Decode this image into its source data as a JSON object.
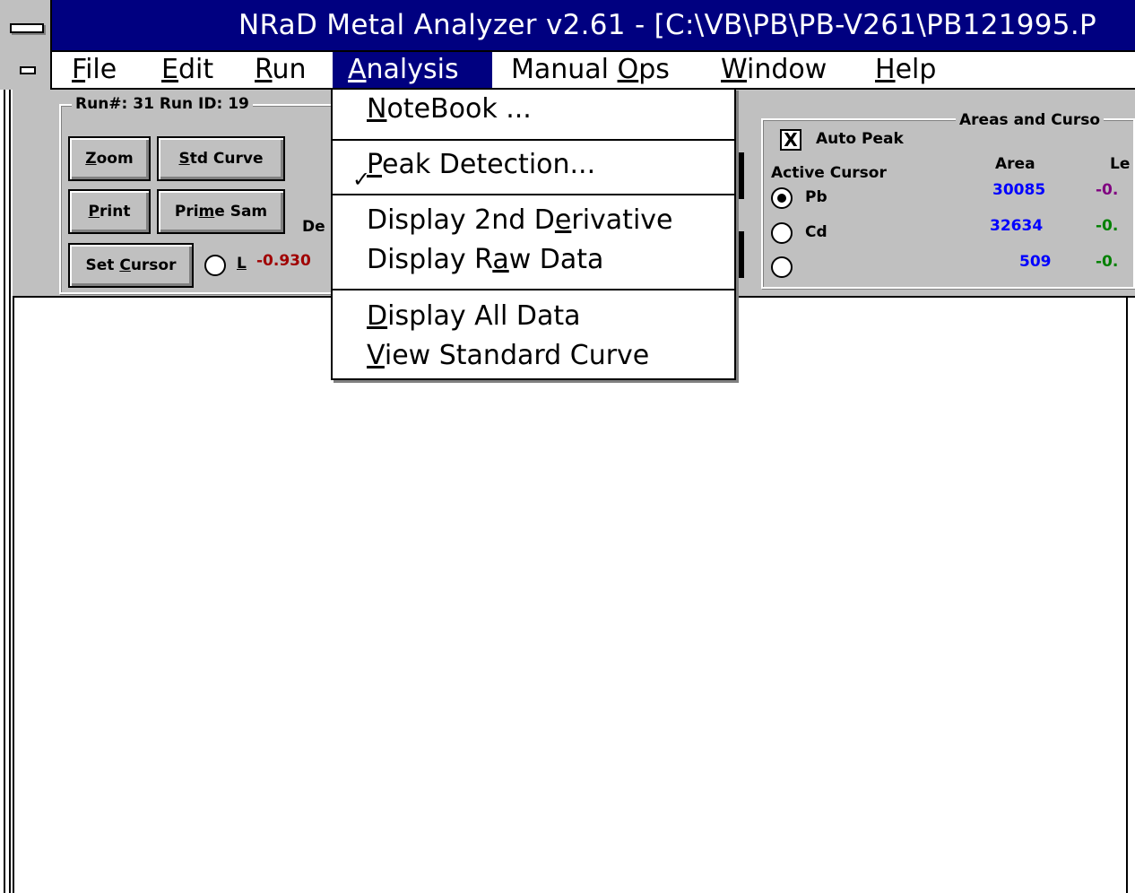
{
  "window": {
    "title": "NRaD Metal Analyzer v2.61 - [C:\\VB\\PB\\PB-V261\\PB121995.P"
  },
  "menubar": {
    "items": [
      {
        "label": "File",
        "mnemonic": "F",
        "rest": "ile"
      },
      {
        "label": "Edit",
        "mnemonic": "E",
        "rest": "dit"
      },
      {
        "label": "Run",
        "mnemonic": "R",
        "rest": "un"
      },
      {
        "label": "Analysis",
        "mnemonic": "A",
        "rest": "nalysis"
      },
      {
        "label": "Manual Ops",
        "pre": "Manual ",
        "mnemonic": "O",
        "rest": "ps"
      },
      {
        "label": "Window",
        "mnemonic": "W",
        "rest": "indow"
      },
      {
        "label": "Help",
        "mnemonic": "H",
        "rest": "elp"
      }
    ]
  },
  "analysis_menu": {
    "items": [
      {
        "pre": "",
        "mnemonic": "N",
        "rest": "oteBook ..."
      },
      {
        "pre": "",
        "mnemonic": "P",
        "rest": "eak Detection...",
        "checked": true,
        "check": "✓"
      },
      {
        "pre": "Display 2nd D",
        "mnemonic": "e",
        "rest": "rivative"
      },
      {
        "pre": "Display R",
        "mnemonic": "a",
        "rest": "w Data"
      },
      {
        "pre": "",
        "mnemonic": "D",
        "rest": "isplay All Data"
      },
      {
        "pre": "",
        "mnemonic": "V",
        "rest": "iew Standard Curve"
      }
    ]
  },
  "run_group": {
    "label": "Run#: 31 Run ID: 19",
    "buttons": {
      "zoom": {
        "mnemonic": "Z",
        "rest": "oom"
      },
      "std_curve": {
        "mnemonic": "S",
        "rest": "td Curve"
      },
      "print": {
        "mnemonic": "P",
        "rest": "rint"
      },
      "prime_sam": {
        "pre": "Pri",
        "mnemonic": "m",
        "rest": "e Sam"
      },
      "set_cursor": {
        "pre": "Set ",
        "mnemonic": "C",
        "rest": "ursor"
      }
    },
    "partial_label": "De",
    "cursor_radio_label": "L",
    "cursor_value": "-0.930",
    "cursor_value_color": "#a00000"
  },
  "areas_group": {
    "label": "Areas and Curso",
    "auto_peak": {
      "label": "Auto Peak",
      "checked": true,
      "mark": "X"
    },
    "active_cursor_label": "Active Cursor",
    "col_area": "Area",
    "col_partial": "Le",
    "rows": [
      {
        "element": "Pb",
        "selected": true,
        "area": "30085",
        "partial": "-0.",
        "partial_color": "#800080"
      },
      {
        "element": "Cd",
        "selected": false,
        "area": "32634",
        "partial": "-0.",
        "partial_color": "#008000"
      },
      {
        "element": "",
        "selected": false,
        "area": "509",
        "partial": "-0.",
        "partial_color": "#008000"
      }
    ],
    "area_color": "#0000ff"
  }
}
